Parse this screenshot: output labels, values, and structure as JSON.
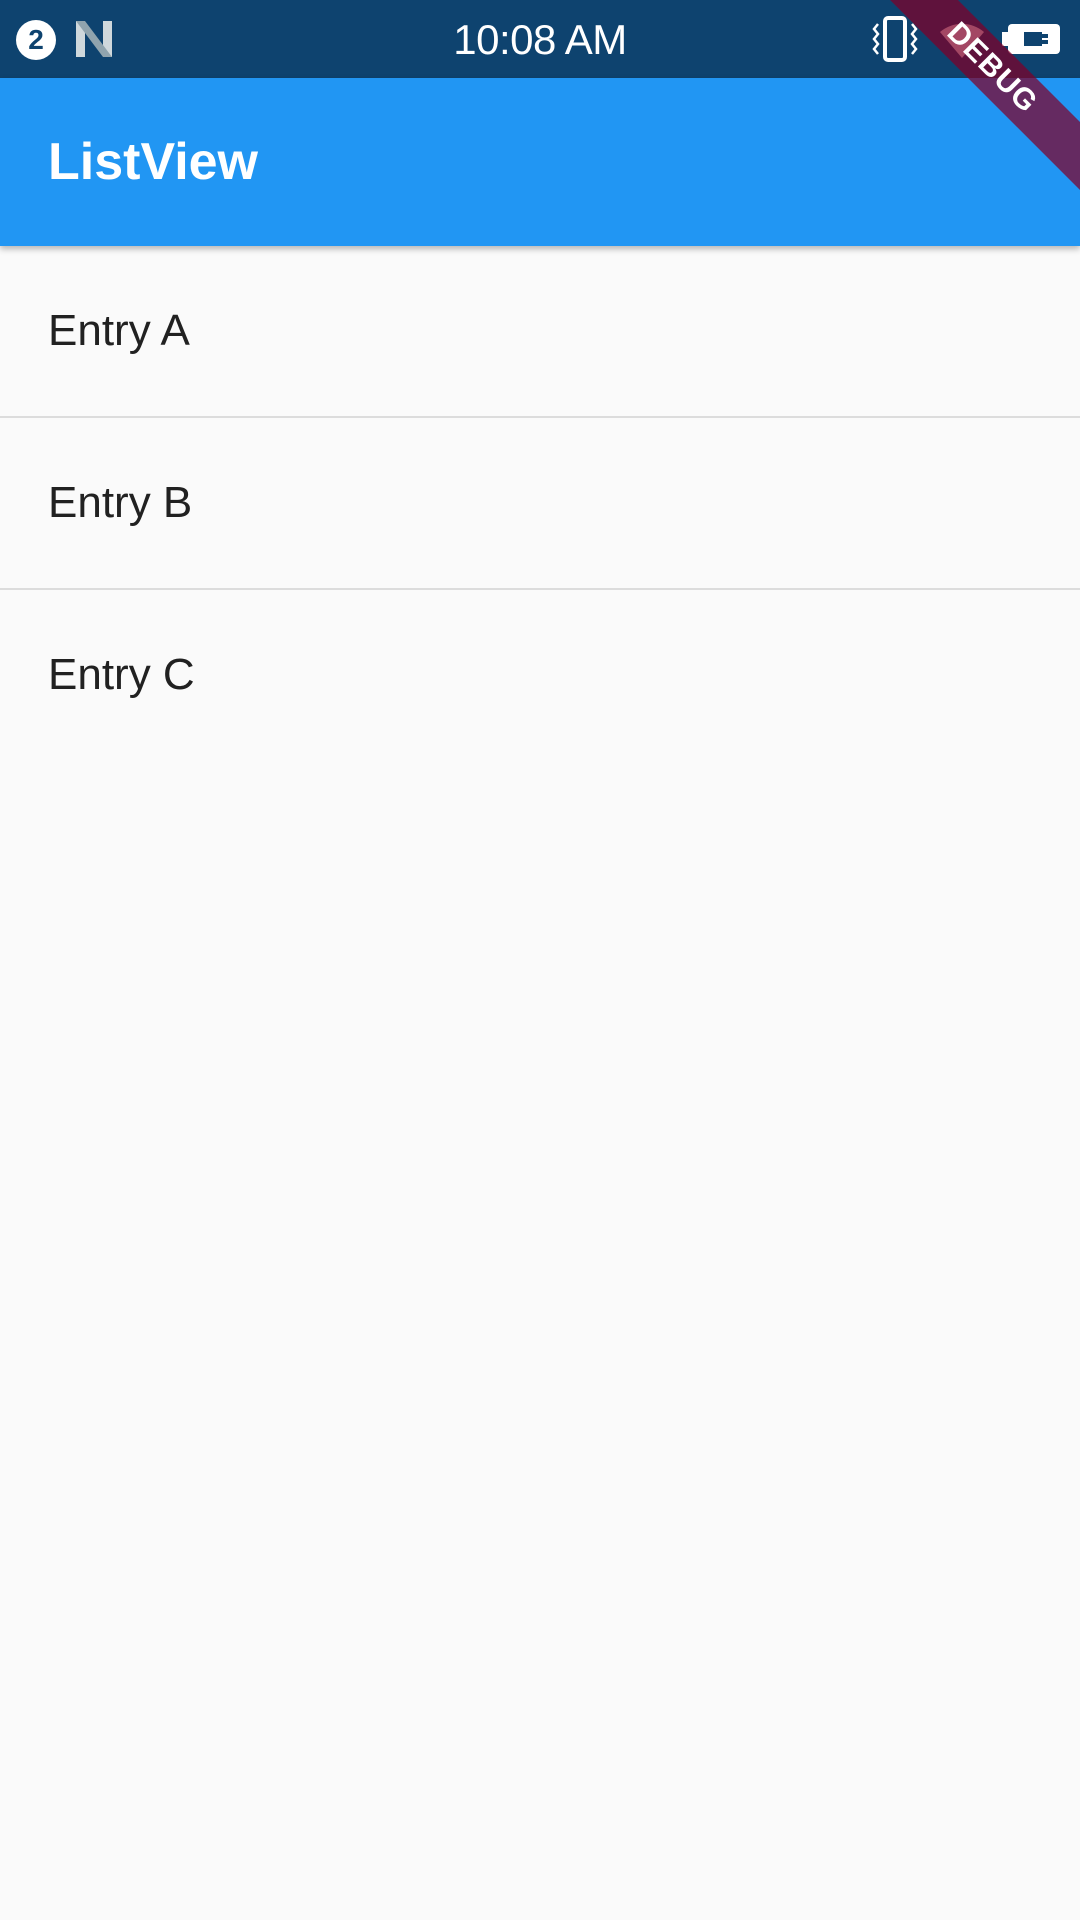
{
  "status_bar": {
    "notification_count": "2",
    "time": "10:08 AM",
    "icons": [
      "notification-count-icon",
      "n-icon",
      "vibrate-icon",
      "wifi-icon",
      "battery-charging-icon"
    ]
  },
  "app_bar": {
    "title": "ListView",
    "color": "#2196f3"
  },
  "list": {
    "items": [
      {
        "label": "Entry A"
      },
      {
        "label": "Entry B"
      },
      {
        "label": "Entry C"
      }
    ]
  },
  "debug_banner": {
    "label": "DEBUG",
    "color": "#800028"
  },
  "colors": {
    "status_bar": "#0e436f",
    "background": "#fafafa",
    "text": "#212121",
    "divider": "#dcdcdc"
  }
}
